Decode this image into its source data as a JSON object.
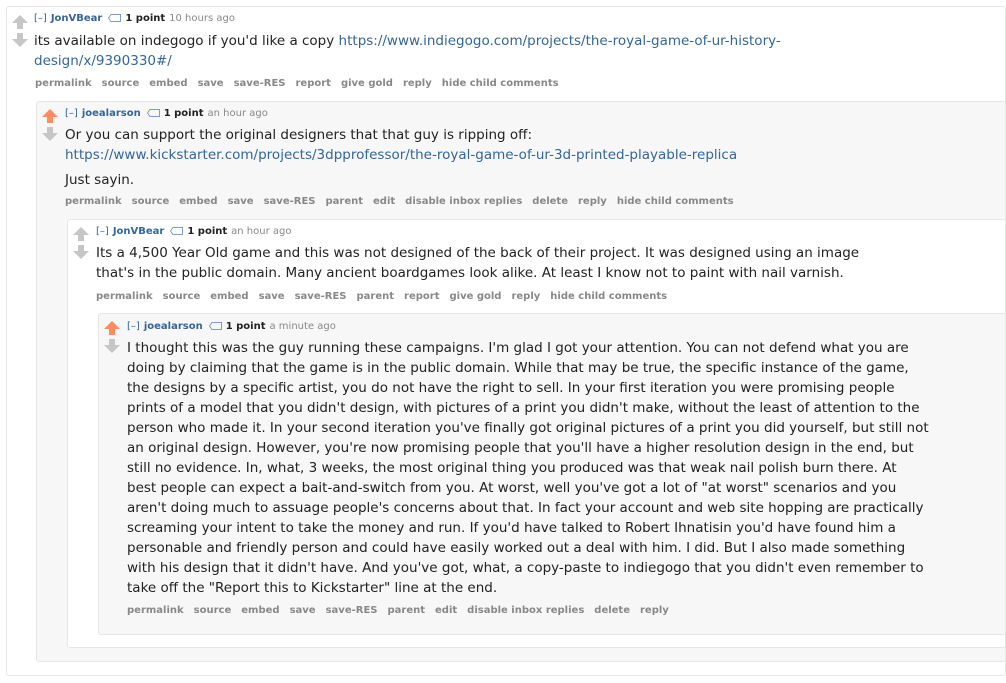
{
  "comments": [
    {
      "expand": "[–]",
      "author": "JonVBear",
      "score": "1 point",
      "time": "10 hours ago",
      "text": "its available on indegogo if you'd like a copy ",
      "link_line1": "https://www.indiegogo.com/projects/the-royal-game-of-ur-history-",
      "link_line2": "design/x/9390330#/",
      "actions": [
        "permalink",
        "source",
        "embed",
        "save",
        "save-RES",
        "report",
        "give gold",
        "reply",
        "hide child comments"
      ]
    },
    {
      "expand": "[–]",
      "author": "joealarson",
      "score": "1 point",
      "time": "an hour ago",
      "line1": "Or you can support the original designers that that guy is ripping off:",
      "link": "https://www.kickstarter.com/projects/3dpprofessor/the-royal-game-of-ur-3d-printed-playable-replica",
      "line2": "Just sayin.",
      "actions": [
        "permalink",
        "source",
        "embed",
        "save",
        "save-RES",
        "parent",
        "edit",
        "disable inbox replies",
        "delete",
        "reply",
        "hide child comments"
      ]
    },
    {
      "expand": "[–]",
      "author": "JonVBear",
      "score": "1 point",
      "time": "an hour ago",
      "line1": "Its a 4,500 Year Old game and this was not designed of the back of their project. It was designed using an image",
      "line2": "that's in the public domain. Many ancient boardgames look alike. At least I know not to paint with nail varnish.",
      "actions": [
        "permalink",
        "source",
        "embed",
        "save",
        "save-RES",
        "parent",
        "report",
        "give gold",
        "reply",
        "hide child comments"
      ]
    },
    {
      "expand": "[–]",
      "author": "joealarson",
      "score": "1 point",
      "time": "a minute ago",
      "lines": [
        "I thought this was the guy running these campaigns. I'm glad I got your attention. You can not defend what you are",
        "doing by claiming that the game is in the public domain. While that may be true, the specific instance of the game,",
        "the designs by a specific artist, you do not have the right to sell. In your first iteration you were promising people",
        "prints of a model that you didn't design, with pictures of a print you didn't make, without the least of attention to the",
        "person who made it. In your second iteration you've finally got original pictures of a print you did yourself, but still not",
        "an original design. However, you're now promising people that you'll have a higher resolution design in the end, but",
        "still no evidence. In, what, 3 weeks, the most original thing you produced was that weak nail polish burn there. At",
        "best people can expect a bait-and-switch from you. At worst, well you've got a lot of \"at worst\" scenarios and you",
        "aren't doing much to assuage people's concerns about that. In fact your account and web site hopping are practically",
        "screaming your intent to take the money and run. If you'd have talked to Robert Ihnatisin you'd have found him a",
        "personable and friendly person and could have easily worked out a deal with him. I did. But I also made something",
        "with his design that it didn't have. And you've got, what, a copy-paste to indiegogo that you didn't even remember to",
        "take off the \"Report this to Kickstarter\" line at the end."
      ],
      "actions": [
        "permalink",
        "source",
        "embed",
        "save",
        "save-RES",
        "parent",
        "edit",
        "disable inbox replies",
        "delete",
        "reply"
      ]
    }
  ],
  "colors": {
    "upvoted": "#ff8b60",
    "neutral": "#c6c6c6",
    "link": "#336699",
    "meta": "#888888"
  }
}
